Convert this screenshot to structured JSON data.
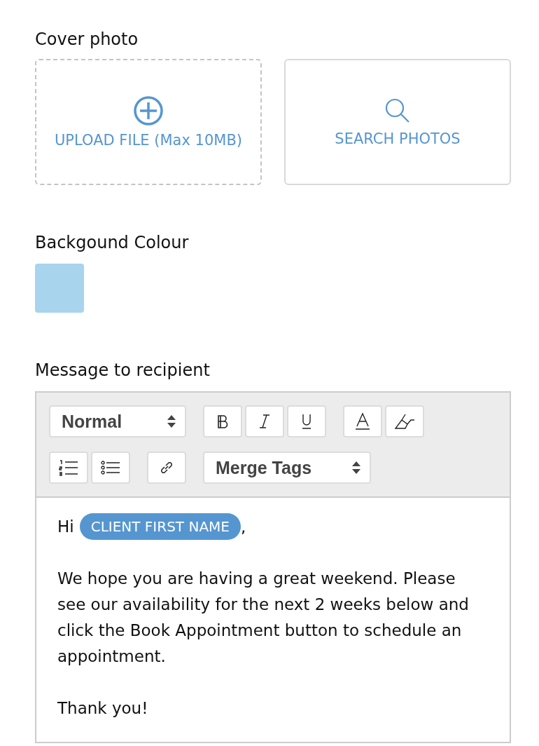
{
  "cover_photo": {
    "label": "Cover photo",
    "options": [
      {
        "kind": "upload",
        "label": "UPLOAD FILE (Max 10MB)"
      },
      {
        "kind": "search",
        "label": "SEARCH PHOTOS"
      }
    ]
  },
  "background": {
    "label": "Backgound Colour",
    "color": "#a8d4ee"
  },
  "message": {
    "label": "Message to recipient",
    "toolbar": [
      [
        {
          "kind": "select",
          "value": "Normal"
        }
      ],
      [
        {
          "kind": "bold"
        },
        {
          "kind": "italic"
        },
        {
          "kind": "underline"
        }
      ],
      [
        {
          "kind": "font-color"
        },
        {
          "kind": "highlight"
        }
      ],
      [
        {
          "kind": "ordered-list"
        },
        {
          "kind": "bullet-list"
        }
      ],
      [
        {
          "kind": "link"
        }
      ],
      [
        {
          "kind": "select",
          "value": "Merge Tags"
        }
      ]
    ],
    "greeting": {
      "before": "Hi",
      "tag": "CLIENT FIRST NAME",
      "after": ","
    },
    "paragraphs": [
      "We hope you are having a great weekend. Please see our availability for the next 2 weeks below and click the Book Appointment button to schedule an appointment.",
      "Thank you!"
    ]
  }
}
